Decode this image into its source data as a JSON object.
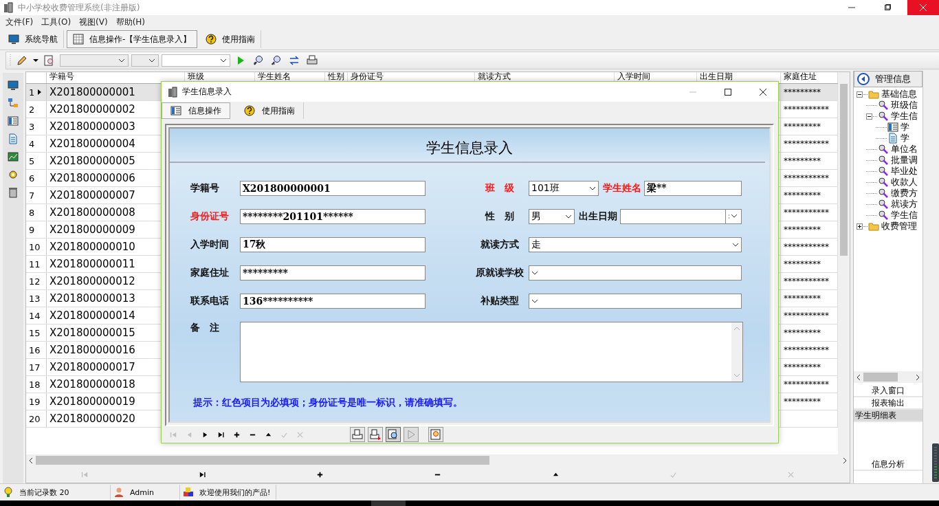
{
  "window": {
    "title": "中小学校收费管理系统(非注册版)"
  },
  "menu": [
    "文件(F)",
    "工具(O)",
    "视图(V)",
    "帮助(H)"
  ],
  "nav_tabs": [
    {
      "label": "系统导航",
      "selected": false,
      "kind": "monitor"
    },
    {
      "label": "信息操作-【学生信息录入】",
      "selected": true,
      "kind": "grid"
    },
    {
      "label": "使用指南",
      "selected": false,
      "kind": "help"
    }
  ],
  "grid": {
    "columns": [
      "学籍号",
      "班级",
      "学生姓名",
      "性别",
      "身份证号",
      "就读方式",
      "入学时间",
      "出生日期",
      "家庭住址"
    ],
    "rows": [
      {
        "number": "1",
        "id": "X201800000001",
        "address": "*********",
        "selected": true
      },
      {
        "number": "2",
        "id": "X201800000002",
        "address": "***********",
        "selected": false
      },
      {
        "number": "3",
        "id": "X201800000003",
        "address": "*********",
        "selected": false
      },
      {
        "number": "4",
        "id": "X201800000004",
        "address": "***********",
        "selected": false
      },
      {
        "number": "5",
        "id": "X201800000005",
        "address": "*********",
        "selected": false
      },
      {
        "number": "6",
        "id": "X201800000006",
        "address": "***********",
        "selected": false
      },
      {
        "number": "7",
        "id": "X201800000007",
        "address": "*********",
        "selected": false
      },
      {
        "number": "8",
        "id": "X201800000008",
        "address": "***********",
        "selected": false
      },
      {
        "number": "9",
        "id": "X201800000009",
        "address": "*********",
        "selected": false
      },
      {
        "number": "10",
        "id": "X201800000010",
        "address": "***********",
        "selected": false
      },
      {
        "number": "11",
        "id": "X201800000011",
        "address": "*********",
        "selected": false
      },
      {
        "number": "12",
        "id": "X201800000012",
        "address": "***********",
        "selected": false
      },
      {
        "number": "13",
        "id": "X201800000013",
        "address": "*********",
        "selected": false
      },
      {
        "number": "14",
        "id": "X201800000014",
        "address": "***********",
        "selected": false
      },
      {
        "number": "15",
        "id": "X201800000015",
        "address": "*********",
        "selected": false
      },
      {
        "number": "16",
        "id": "X201800000016",
        "address": "***********",
        "selected": false
      },
      {
        "number": "17",
        "id": "X201800000017",
        "address": "*********",
        "selected": false
      },
      {
        "number": "18",
        "id": "X201800000018",
        "address": "***********",
        "selected": false
      },
      {
        "number": "19",
        "id": "X201800000019",
        "address": "*********",
        "selected": false
      },
      {
        "number": "20",
        "id": "X201800000020",
        "selected": false
      }
    ],
    "nav": [
      {
        "kind": "first",
        "disabled": true
      },
      {
        "kind": "last",
        "disabled": false
      },
      {
        "kind": "add",
        "disabled": false
      },
      {
        "kind": "delete",
        "disabled": false
      },
      {
        "kind": "up",
        "disabled": false
      },
      {
        "kind": "post",
        "disabled": true
      },
      {
        "kind": "cancel",
        "disabled": true
      }
    ]
  },
  "tree_panel": {
    "title": "管理信息",
    "tree": [
      {
        "label": "基础信息",
        "kind": "folder",
        "expanded": true,
        "children": [
          {
            "label": "班级信",
            "kind": "tool"
          },
          {
            "label": "学生信",
            "kind": "tool",
            "expanded": true,
            "children": [
              {
                "label": "学",
                "kind": "form"
              },
              {
                "label": "学",
                "kind": "doc"
              }
            ]
          },
          {
            "label": "单位名",
            "kind": "tool"
          },
          {
            "label": "批量调",
            "kind": "tool"
          },
          {
            "label": "毕业处",
            "kind": "tool"
          },
          {
            "label": "收款人",
            "kind": "tool"
          },
          {
            "label": "缴费方",
            "kind": "tool"
          },
          {
            "label": "就读方",
            "kind": "tool"
          },
          {
            "label": "学生信",
            "kind": "tool"
          }
        ]
      },
      {
        "label": "收费管理",
        "kind": "folder",
        "expanded": false
      }
    ],
    "list": [
      {
        "label": "录入窗口",
        "selected": false
      },
      {
        "label": "报表输出",
        "selected": false
      },
      {
        "label": "学生明细表",
        "selected": true
      }
    ],
    "bottom_item": "信息分析"
  },
  "status_bar": [
    {
      "kind": "records",
      "text": "当前记录数 20"
    },
    {
      "kind": "user",
      "text": "Admin"
    },
    {
      "kind": "welcome",
      "text": "欢迎使用我们的产品!"
    }
  ],
  "dialog": {
    "title": "学生信息录入",
    "tabs": [
      {
        "label": "信息操作",
        "selected": true,
        "kind": "form"
      },
      {
        "label": "使用指南",
        "selected": false,
        "kind": "help"
      }
    ],
    "heading": "学生信息录入",
    "rows": [
      {
        "left": {
          "label": "学籍号",
          "value": "X201800000001",
          "kind": "text",
          "required": false
        },
        "right": [
          {
            "label": "班　级",
            "value": "101班",
            "kind": "select",
            "required": true
          },
          {
            "label": "学生姓名",
            "value": "梁**",
            "kind": "text",
            "required": true
          }
        ]
      },
      {
        "left": {
          "label": "身份证号",
          "value": "********201101******",
          "kind": "text",
          "required": true
        },
        "right": [
          {
            "label": "性　别",
            "value": "男",
            "kind": "select",
            "required": false
          },
          {
            "label": "出生日期",
            "kind": "date",
            "required": false
          }
        ]
      },
      {
        "left": {
          "label": "入学时间",
          "value": "17秋",
          "kind": "text",
          "required": false
        },
        "right": [
          {
            "label": "就读方式",
            "value": "走",
            "kind": "select",
            "required": false
          }
        ]
      },
      {
        "left": {
          "label": "家庭住址",
          "value": "*********",
          "kind": "text",
          "required": false
        },
        "right": [
          {
            "label": "原就读学校",
            "kind": "select",
            "required": false
          }
        ]
      },
      {
        "left": {
          "label": "联系电话",
          "value": "136**********",
          "kind": "text",
          "required": false
        },
        "right": [
          {
            "label": "补贴类型",
            "kind": "select",
            "required": false
          }
        ]
      }
    ],
    "remarks_label": "备　注",
    "hint": "提示：红色项目为必填项；身份证号是唯一标识，请准确填写。",
    "nav": [
      {
        "kind": "first",
        "disabled": true
      },
      {
        "kind": "prev",
        "disabled": true
      },
      {
        "kind": "next",
        "disabled": false
      },
      {
        "kind": "last",
        "disabled": false
      },
      {
        "kind": "add",
        "disabled": false
      },
      {
        "kind": "delete",
        "disabled": false
      },
      {
        "kind": "up",
        "disabled": false
      },
      {
        "kind": "post",
        "disabled": true
      },
      {
        "kind": "cancel",
        "disabled": true
      }
    ]
  }
}
